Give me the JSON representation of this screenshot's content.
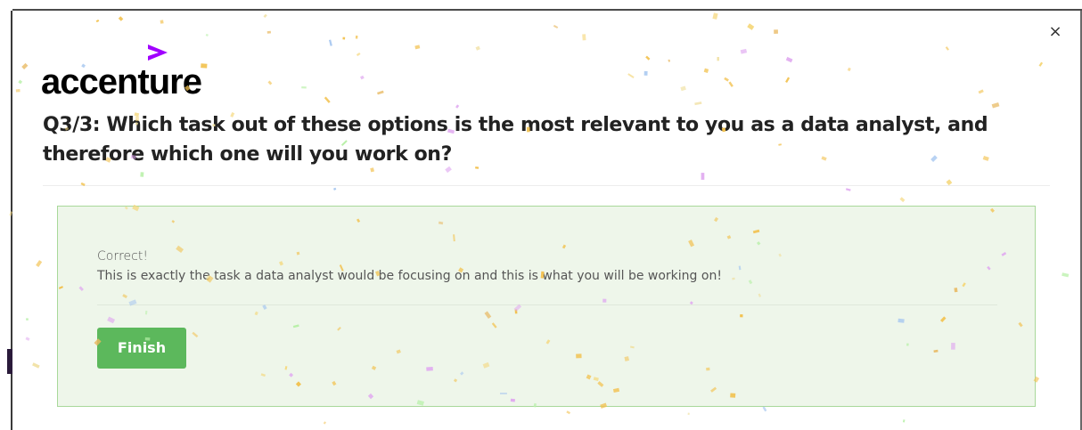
{
  "modal": {
    "close_label": "×",
    "logo": {
      "text": "accenture",
      "chevron_color": "#a100ff"
    },
    "question": "Q3/3: Which task out of these options is the most relevant to you as a data analyst, and therefore which one will you work on?",
    "feedback": {
      "title": "Correct!",
      "message": "This is exactly the task a data analyst would be focusing on and this is what you will be working on!",
      "border_color": "#a8d89a",
      "background_color": "#eef6ea"
    },
    "finish_label": "Finish",
    "finish_color": "#5cb85c"
  },
  "icons": {
    "close": "close-icon",
    "logo_mark": "chevron-right-icon"
  }
}
